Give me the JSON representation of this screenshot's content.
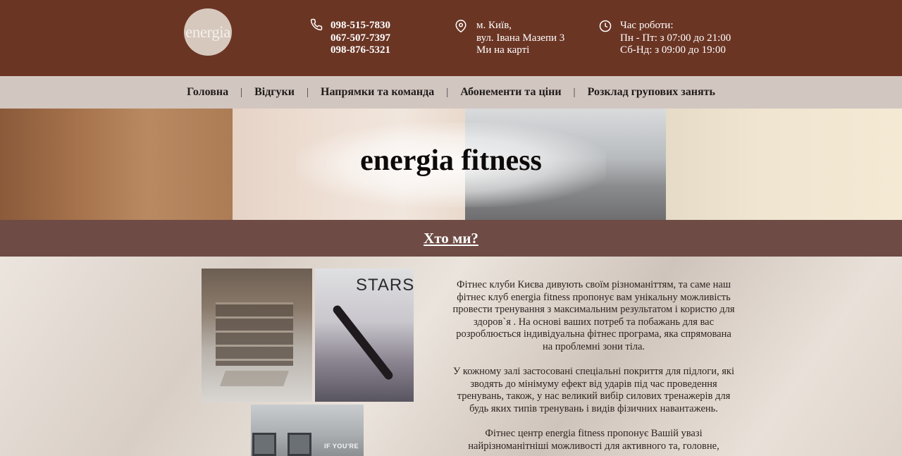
{
  "header": {
    "logo_text": "energia",
    "phones": [
      "098-515-7830",
      "067-507-7397",
      "098-876-5321"
    ],
    "address": [
      "м. Київ,",
      "вул. Івана Мазепи 3",
      "Ми на карті"
    ],
    "hours": [
      "Час роботи:",
      "Пн - Пт: з 07:00 до 21:00",
      "Сб-Нд: з 09:00 до 19:00"
    ],
    "icons": [
      "phone-icon",
      "map-pin-icon",
      "clock-icon"
    ]
  },
  "nav": {
    "items": [
      "Головна",
      "Відгуки",
      "Напрямки та команда",
      "Абонементи та ціни",
      "Розклад групових занять"
    ],
    "separator": "|"
  },
  "hero": {
    "title": "energia fitness"
  },
  "about": {
    "title": "Хто ми?",
    "photo_texts": [
      "STARST",
      "IF YOU'RE"
    ],
    "paragraphs": [
      "Фітнес клуби Києва дивують своїм різноманіттям, та саме наш фітнес клуб energia fitness пропонує вам унікальну можливість провести тренування з максимальним результатом і користю для здоров`я . На основі ваших потреб та побажань для вас розроблюється індивідуальна фітнес програма, яка спрямована на проблемні зони тіла.",
      "У кожному залі застосовані спеціальні покриття для підлоги, які зводять до мінімуму ефект від ударів під час проведення тренувань, також, у нас великий вибір силових тренажерів для будь яких типів тренувань і видів фізичних навантажень.",
      "Фітнес центр energia fitness пропонує Вашій увазі найрізноманітніші можливості для активного та, головне,"
    ]
  },
  "colors": {
    "header_bg": "#6b3524",
    "nav_bg": "#d2c6c0",
    "section_bar": "#6e4b44"
  }
}
